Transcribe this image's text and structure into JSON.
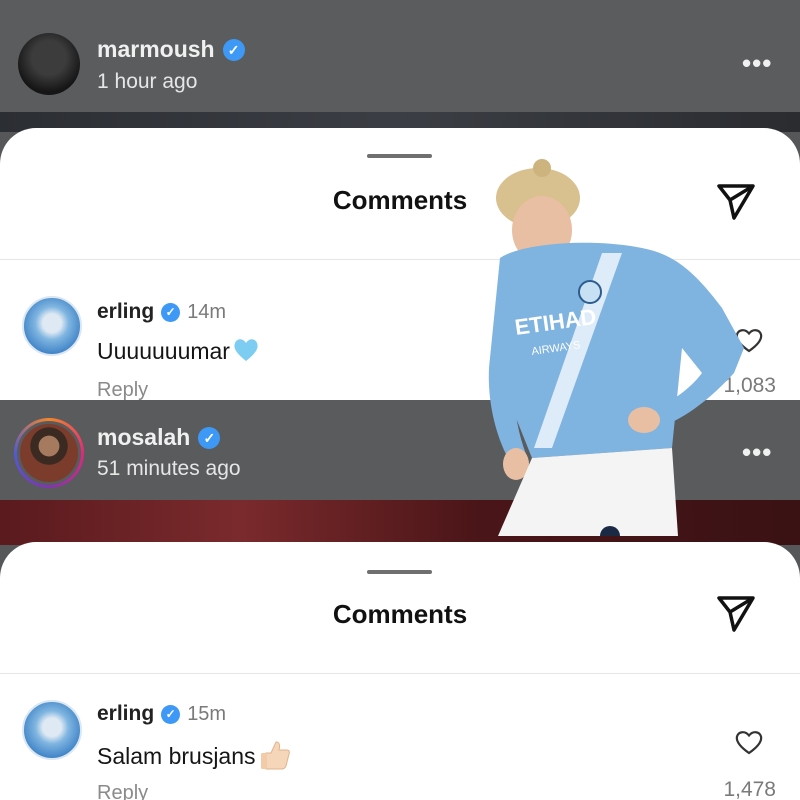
{
  "posts": [
    {
      "username": "marmoush",
      "time_ago": "1 hour ago",
      "more_icon": "more-horizontal-icon"
    },
    {
      "username": "mosalah",
      "time_ago": "51 minutes ago",
      "more_icon": "more-horizontal-icon"
    }
  ],
  "sheets": [
    {
      "title": "Comments",
      "comment": {
        "username": "erling",
        "time": "14m",
        "text": "Uuuuuuumar",
        "emoji": "light-blue-heart-emoji",
        "reply_label": "Reply",
        "likes": "1,083"
      }
    },
    {
      "title": "Comments",
      "comment": {
        "username": "erling",
        "time": "15m",
        "text": "Salam brusjans",
        "emoji": "thumbs-up-emoji",
        "reply_label": "Reply",
        "likes": "1,478"
      }
    }
  ],
  "colors": {
    "verified_blue": "#3d99f5",
    "sheet_bg": "#ffffff",
    "overlay_gray": "#5a5c5e",
    "kit_sky_blue": "#7fb3e0"
  },
  "player_kit_text": {
    "sponsor": "ETIHAD",
    "sponsor_sub": "AIRWAYS"
  }
}
